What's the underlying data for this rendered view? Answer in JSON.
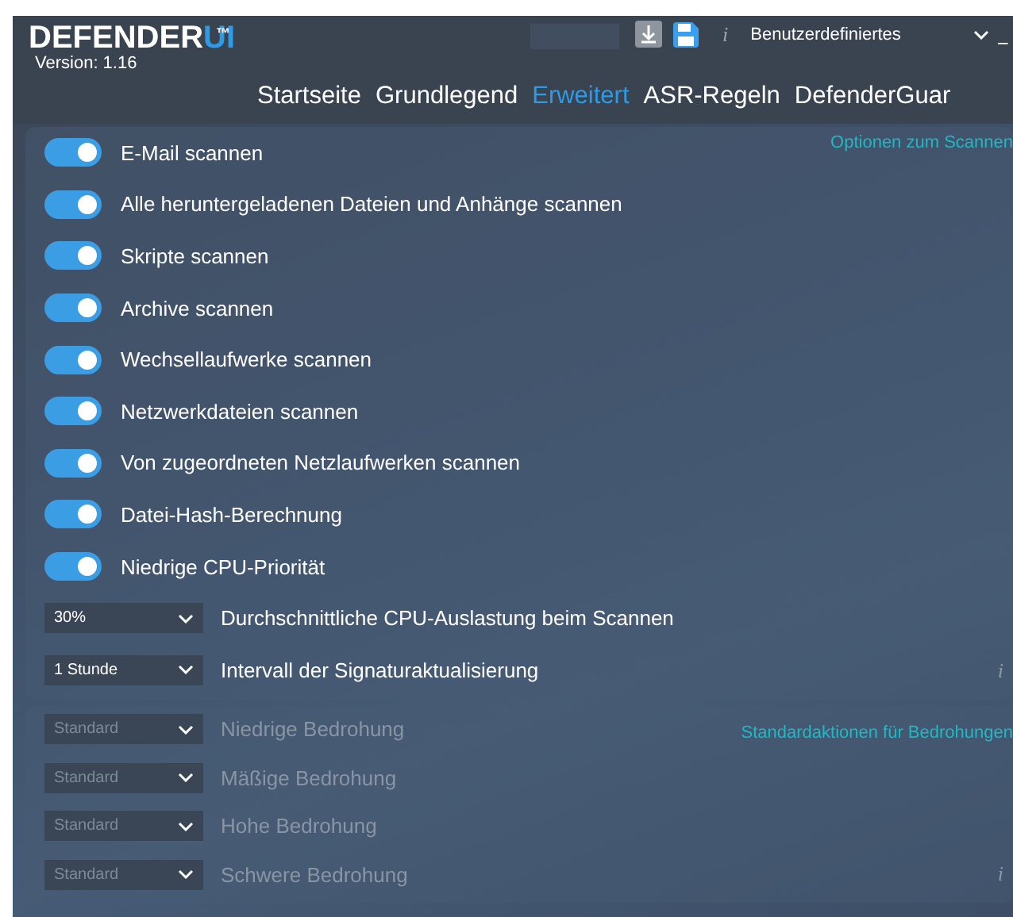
{
  "header": {
    "logo_main": "DEFENDER",
    "logo_accent": "UI",
    "trademark": "™",
    "version": "Version: 1.16",
    "profile": "Benutzerdefiniertes",
    "info": "i",
    "minimize": "_"
  },
  "tabs": [
    {
      "label": "Startseite",
      "selected": false
    },
    {
      "label": "Grundlegend",
      "selected": false
    },
    {
      "label": "Erweitert",
      "selected": true
    },
    {
      "label": "ASR-Regeln",
      "selected": false
    },
    {
      "label": "DefenderGuar",
      "selected": false
    }
  ],
  "sections": [
    {
      "title": "Optionen zum Scannen",
      "disabled": false,
      "info": "i",
      "rows": [
        {
          "kind": "toggle",
          "label": "E-Mail scannen",
          "on": true
        },
        {
          "kind": "toggle",
          "label": "Alle heruntergeladenen Dateien und Anhänge scannen",
          "on": true
        },
        {
          "kind": "toggle",
          "label": "Skripte scannen",
          "on": true
        },
        {
          "kind": "toggle",
          "label": "Archive scannen",
          "on": true
        },
        {
          "kind": "toggle",
          "label": "Wechsellaufwerke scannen",
          "on": true
        },
        {
          "kind": "toggle",
          "label": "Netzwerkdateien scannen",
          "on": true
        },
        {
          "kind": "toggle",
          "label": "Von zugeordneten Netzlaufwerken scannen",
          "on": true
        },
        {
          "kind": "toggle",
          "label": "Datei-Hash-Berechnung",
          "on": true
        },
        {
          "kind": "toggle",
          "label": "Niedrige CPU-Priorität",
          "on": true
        },
        {
          "kind": "select",
          "label": "Durchschnittliche CPU-Auslastung beim Scannen",
          "value": "30%"
        },
        {
          "kind": "select",
          "label": "Intervall der Signaturaktualisierung",
          "value": "1 Stunde"
        }
      ]
    },
    {
      "title": "Standardaktionen für Bedrohungen",
      "disabled": true,
      "info": "i",
      "rows": [
        {
          "kind": "select",
          "label": "Niedrige Bedrohung",
          "value": "Standard"
        },
        {
          "kind": "select",
          "label": "Mäßige Bedrohung",
          "value": "Standard"
        },
        {
          "kind": "select",
          "label": "Hohe Bedrohung",
          "value": "Standard"
        },
        {
          "kind": "select",
          "label": "Schwere Bedrohung",
          "value": "Standard"
        }
      ]
    }
  ]
}
